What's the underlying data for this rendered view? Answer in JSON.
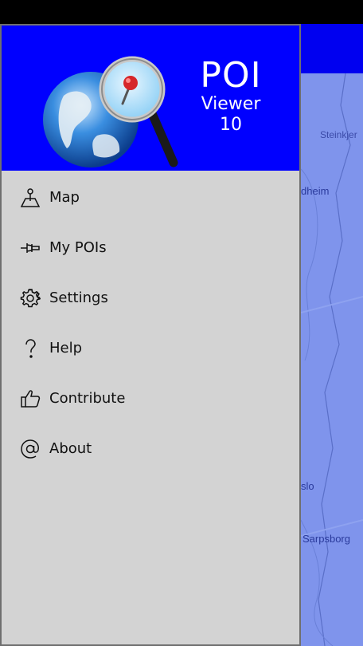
{
  "app": {
    "title_main": "POI",
    "title_line2": "Viewer",
    "title_line3": "10"
  },
  "menu": {
    "items": [
      {
        "label": "Map",
        "icon": "map-icon"
      },
      {
        "label": "My POIs",
        "icon": "pin-icon"
      },
      {
        "label": "Settings",
        "icon": "gear-icon"
      },
      {
        "label": "Help",
        "icon": "question-icon"
      },
      {
        "label": "Contribute",
        "icon": "thumbs-up-icon"
      },
      {
        "label": "About",
        "icon": "at-icon"
      }
    ]
  },
  "map": {
    "labels": [
      "Steinkjer",
      "dheim",
      "slo",
      "Sarpsborg"
    ]
  },
  "colors": {
    "header_blue": "#0000ff",
    "drawer_bg": "#d3d3d3",
    "map_water": "#7f94ec"
  }
}
